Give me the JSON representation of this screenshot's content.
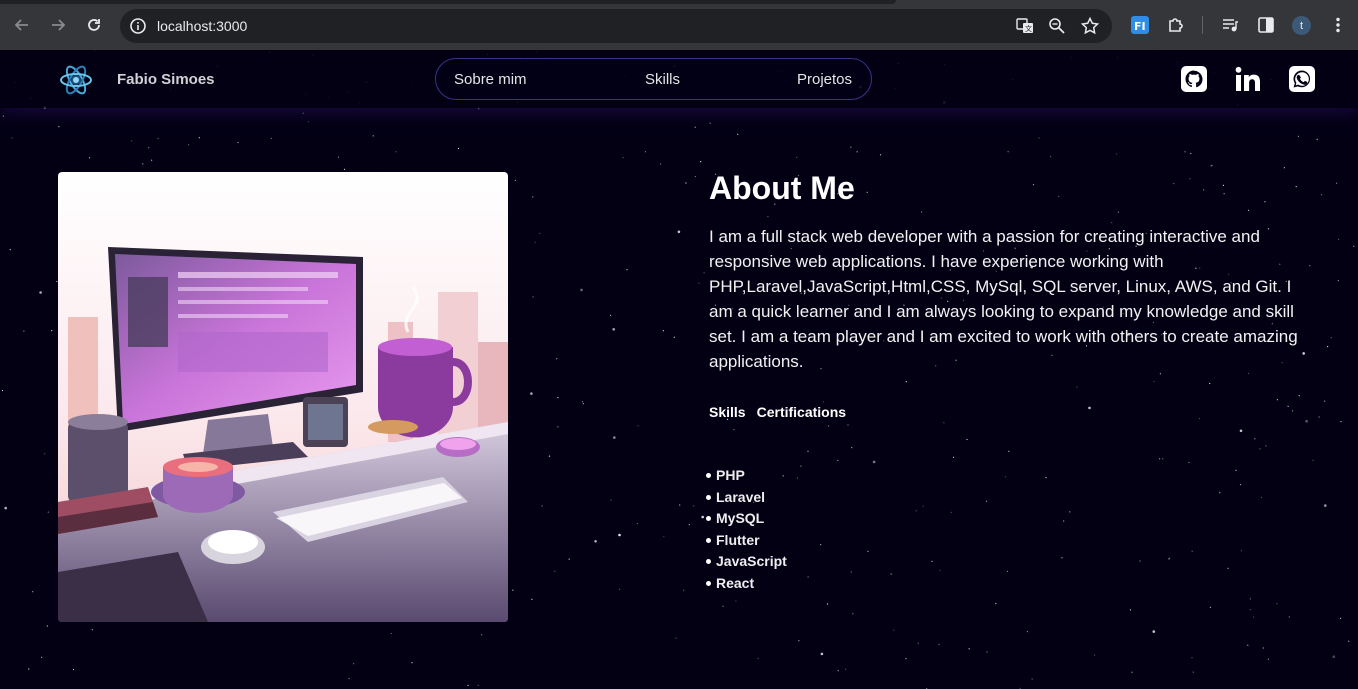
{
  "browser": {
    "url": "localhost:3000",
    "profile_initial": "t",
    "icons": [
      "back-icon",
      "forward-icon",
      "reload-icon",
      "site-info-icon",
      "translate-icon",
      "zoom-icon",
      "bookmark-star-icon",
      "extension-fi-icon",
      "extensions-puzzle-icon",
      "media-control-icon",
      "side-panel-icon",
      "profile-avatar",
      "more-menu-icon"
    ]
  },
  "navbar": {
    "brand": "Fabio Simoes",
    "menu": [
      "Sobre mim",
      "Skills",
      "Projetos"
    ],
    "social": [
      "github-icon",
      "linkedin-icon",
      "whatsapp-icon"
    ]
  },
  "about": {
    "title": "About Me",
    "description": "I am a full stack web developer with a passion for creating interactive and responsive web applications. I have experience working with PHP,Laravel,JavaScript,Html,CSS, MySql, SQL server, Linux, AWS, and Git. I am a quick learner and I am always looking to expand my knowledge and skill set. I am a team player and I am excited to work with others to create amazing applications.",
    "tabs": [
      "Skills",
      "Certifications"
    ],
    "skills": [
      "PHP",
      "Laravel",
      "MySQL",
      "Flutter",
      "JavaScript",
      "React"
    ]
  },
  "colors": {
    "page_bg": "#030014",
    "accent_border": "#3d2f8a",
    "chrome_bg": "#35363a"
  }
}
